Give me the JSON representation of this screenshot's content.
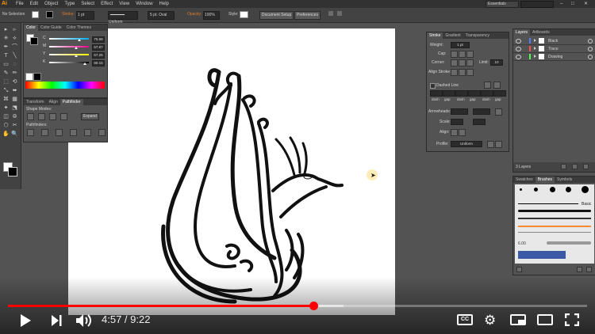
{
  "app": {
    "logo": "Ai",
    "menu": [
      "File",
      "Edit",
      "Object",
      "Type",
      "Select",
      "Effect",
      "View",
      "Window",
      "Help"
    ],
    "workspace": "Essentials",
    "window_buttons": [
      "–",
      "□",
      "✕"
    ]
  },
  "control_bar": {
    "selection": "No Selection",
    "stroke_label": "Stroke:",
    "stroke_value": "1 pt",
    "profile_value": "Uniform",
    "brush_value": "5 pt. Oval",
    "opacity_label": "Opacity:",
    "opacity_value": "100%",
    "style_label": "Style:",
    "doc_setup": "Document Setup",
    "preferences": "Preferences"
  },
  "color_panel": {
    "tabs": [
      "Color",
      "Color Guide",
      "Color Themes"
    ],
    "channels": [
      {
        "name": "C",
        "value": "75.68",
        "level": 0.76,
        "color": "#00aeef"
      },
      {
        "name": "M",
        "value": "67.87",
        "level": 0.68,
        "color": "#ec008c"
      },
      {
        "name": "Y",
        "value": "67.25",
        "level": 0.67,
        "color": "#fff200"
      },
      {
        "name": "K",
        "value": "90.15",
        "level": 0.9,
        "color": "#000000"
      }
    ]
  },
  "pathfinder_panel": {
    "tabs": [
      "Transform",
      "Align",
      "Pathfinder"
    ],
    "shape_modes": "Shape Modes:",
    "expand": "Expand",
    "pathfinders": "Pathfinders:"
  },
  "stroke_panel": {
    "tabs": [
      "Stroke",
      "Gradient",
      "Transparency"
    ],
    "weight_label": "Weight:",
    "weight_value": "1 pt",
    "cap_label": "Cap:",
    "corner_label": "Corner:",
    "limit_label": "Limit:",
    "limit_value": "10",
    "align_label": "Align Stroke:",
    "dashed_label": "Dashed Line",
    "dash_labels": [
      "dash",
      "gap",
      "dash",
      "gap",
      "dash",
      "gap"
    ],
    "arrowheads_label": "Arrowheads:",
    "scale_label": "Scale:",
    "align2_label": "Align:",
    "profile_label": "Profile:",
    "profile_value": "Uniform"
  },
  "layers_panel": {
    "tabs": [
      "Layers",
      "Artboards"
    ],
    "layers": [
      {
        "name": "Black",
        "color": "#4f7fff"
      },
      {
        "name": "Trace",
        "color": "#ff4f4f"
      },
      {
        "name": "Drawing",
        "color": "#4fff4f"
      }
    ],
    "footer": "3 Layers"
  },
  "brushes_panel": {
    "tabs": [
      "Swatches",
      "Brushes",
      "Symbols"
    ],
    "basic_label": "Basic",
    "size_label": "6.00"
  },
  "video": {
    "current_time": "4:57",
    "duration": "9:22",
    "time_display": "4:57 / 9:22",
    "progress": 0.528,
    "buffered": 0.579,
    "cc_label": "CC"
  },
  "colors": {
    "accent": "#ff0000",
    "ui_dark": "#323232",
    "ui_mid": "#535353"
  }
}
